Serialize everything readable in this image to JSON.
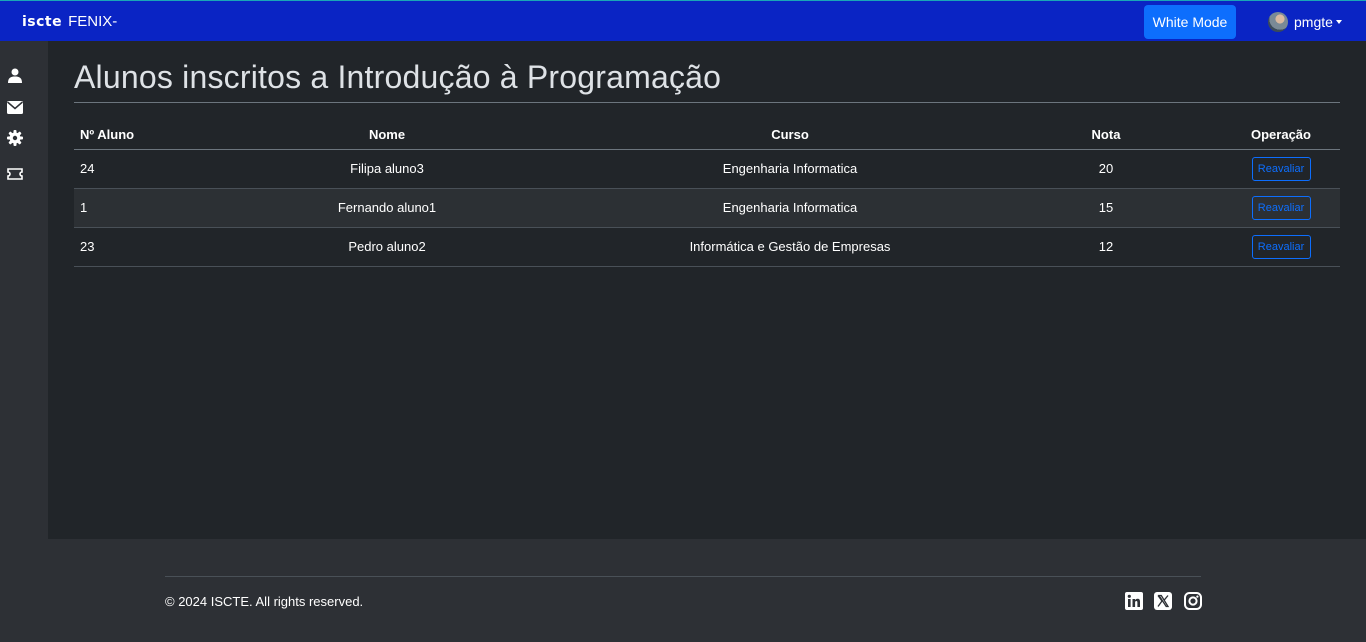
{
  "navbar": {
    "brand_logo": "iscte",
    "brand_app": "FENIX-",
    "theme_button": "White Mode",
    "username": "pmgte"
  },
  "sidebar": {
    "items": [
      {
        "icon": "user-icon"
      },
      {
        "icon": "envelope-icon"
      },
      {
        "icon": "gear-icon"
      },
      {
        "icon": "ticket-icon"
      }
    ]
  },
  "main": {
    "title": "Alunos inscritos a Introdução à Programação",
    "table": {
      "headers": [
        "Nº Aluno",
        "Nome",
        "Curso",
        "Nota",
        "Operação"
      ],
      "rows": [
        {
          "numero": "24",
          "nome": "Filipa aluno3",
          "curso": "Engenharia Informatica",
          "nota": "20",
          "operacao": "Reavaliar"
        },
        {
          "numero": "1",
          "nome": "Fernando aluno1",
          "curso": "Engenharia Informatica",
          "nota": "15",
          "operacao": "Reavaliar"
        },
        {
          "numero": "23",
          "nome": "Pedro aluno2",
          "curso": "Informática e Gestão de Empresas",
          "nota": "12",
          "operacao": "Reavaliar"
        }
      ]
    }
  },
  "footer": {
    "copyright": "© 2024 ISCTE. All rights reserved.",
    "social": [
      "linkedin-icon",
      "x-icon",
      "instagram-icon"
    ]
  },
  "colors": {
    "navbar": "#0a24c4",
    "primary_button": "#0d6efd",
    "main_bg": "#212529",
    "sidebar_bg": "#2d3035"
  }
}
